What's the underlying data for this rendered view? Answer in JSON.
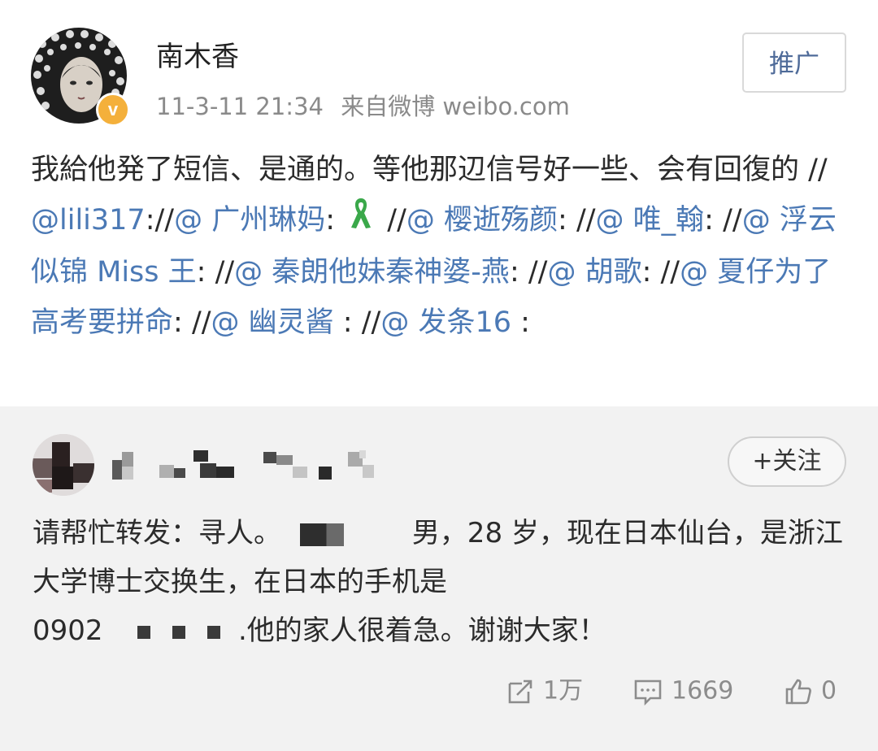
{
  "post": {
    "author": "南木香",
    "timestamp": "11-3-11 21:34",
    "source": "来自微博 weibo.com",
    "promote_label": "推广",
    "text_intro": "我給他発了短信、是通的。等他那辺信号好一些、会有回復的",
    "chain": [
      {
        "sep": " //",
        "mention": "@lili317",
        "after": ":"
      },
      {
        "sep": "//",
        "mention": "@ 广州琳妈",
        "after": ": "
      },
      {
        "sep": " //",
        "mention": "@ 樱逝殇颜",
        "after": ": "
      },
      {
        "sep": "//",
        "mention": "@ 唯_翰",
        "after": ": "
      },
      {
        "sep": "//",
        "mention": "@ 浮云似锦 Miss 王",
        "after": ": "
      },
      {
        "sep": "//",
        "mention": "@ 秦朗他妹秦神婆-燕",
        "after": ": "
      },
      {
        "sep": "//",
        "mention": "@ 胡歌",
        "after": ": "
      },
      {
        "sep": "//",
        "mention": "@ 夏仔为了高考要拼命",
        "after": ": "
      },
      {
        "sep": "//",
        "mention": "@ 幽灵酱",
        "after": " : "
      },
      {
        "sep": "//",
        "mention": "@ 发条16",
        "after": " :"
      }
    ]
  },
  "quoted": {
    "follow_label": "+关注",
    "line1_a": "请帮忙转发：寻人。",
    "line1_b": "男，28 岁，现在日本仙台，是浙江大学博士交换生，在日本的手机是",
    "line3_a": "0902",
    "line3_b": ".他的家人很着急。谢谢大家！",
    "actions": {
      "repost": {
        "icon": "repost-icon",
        "count": "1万"
      },
      "comment": {
        "icon": "comment-icon",
        "count": "1669"
      },
      "like": {
        "icon": "thumbs-up-icon",
        "count": "0"
      }
    }
  },
  "colors": {
    "mention": "#4b79b5",
    "verified_badge": "#f4b03b",
    "quoted_background": "#f2f2f2",
    "meta_text": "#8a8a8a"
  }
}
